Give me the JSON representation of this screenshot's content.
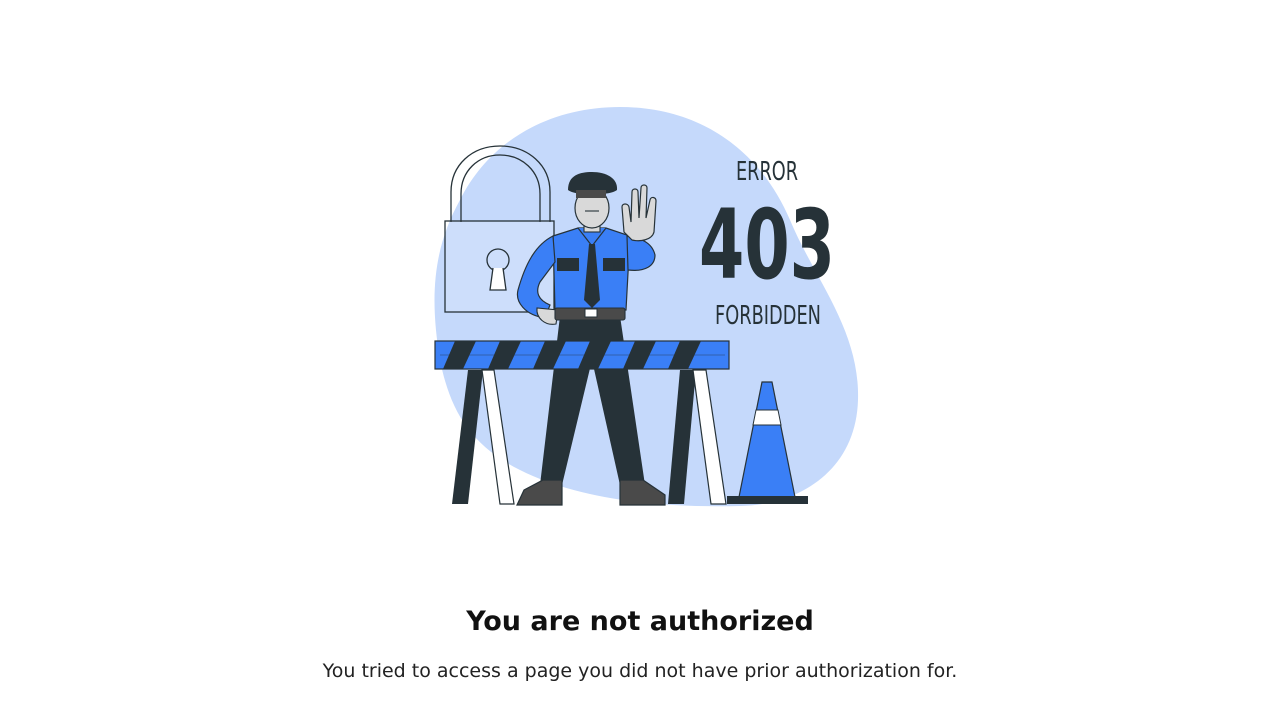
{
  "illustration": {
    "error_label": "ERROR",
    "code": "403",
    "status": "FORBIDDEN",
    "colors": {
      "blob": "#c5d9fb",
      "uniform_blue": "#3a7ff6",
      "dark": "#263238",
      "skin": "#d9d9d9"
    }
  },
  "content": {
    "title": "You are not authorized",
    "message": "You tried to access a page you did not have prior authorization for."
  }
}
